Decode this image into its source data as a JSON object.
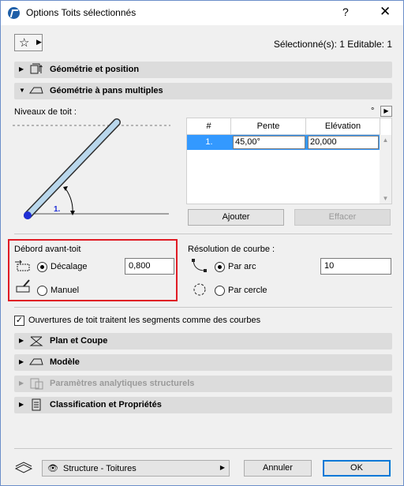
{
  "window": {
    "title": "Options Toits sélectionnés",
    "help": "?",
    "close": "✕"
  },
  "header": {
    "favorites_icon": "star-icon",
    "selection_info": "Sélectionné(s): 1 Editable: 1"
  },
  "sections": {
    "geometry_position": "Géométrie et position",
    "multi_plane": "Géométrie à pans multiples",
    "plan_section": "Plan et Coupe",
    "model": "Modèle",
    "structural": "Paramètres analytiques structurels",
    "classification": "Classification et Propriétés"
  },
  "levels": {
    "label": "Niveaux de toit :",
    "unit": "°",
    "diagram_label": "1.",
    "columns": [
      "#",
      "Pente",
      "Elévation"
    ],
    "rows": [
      {
        "num": "1.",
        "pente": "45,00°",
        "elevation": "20,000"
      }
    ],
    "add_button": "Ajouter",
    "delete_button": "Effacer"
  },
  "eaves": {
    "title": "Débord avant-toit",
    "offset_label": "Décalage",
    "offset_value": "0,800",
    "manual_label": "Manuel",
    "offset_selected": true
  },
  "curve": {
    "title": "Résolution de courbe :",
    "by_arc_label": "Par arc",
    "by_arc_value": "10",
    "by_circle_label": "Par cercle",
    "by_arc_selected": true
  },
  "openings_checkbox": {
    "label": "Ouvertures de toit traitent les segments comme des courbes",
    "checked": true
  },
  "footer": {
    "layer_value": "Structure - Toitures",
    "cancel": "Annuler",
    "ok": "OK"
  }
}
